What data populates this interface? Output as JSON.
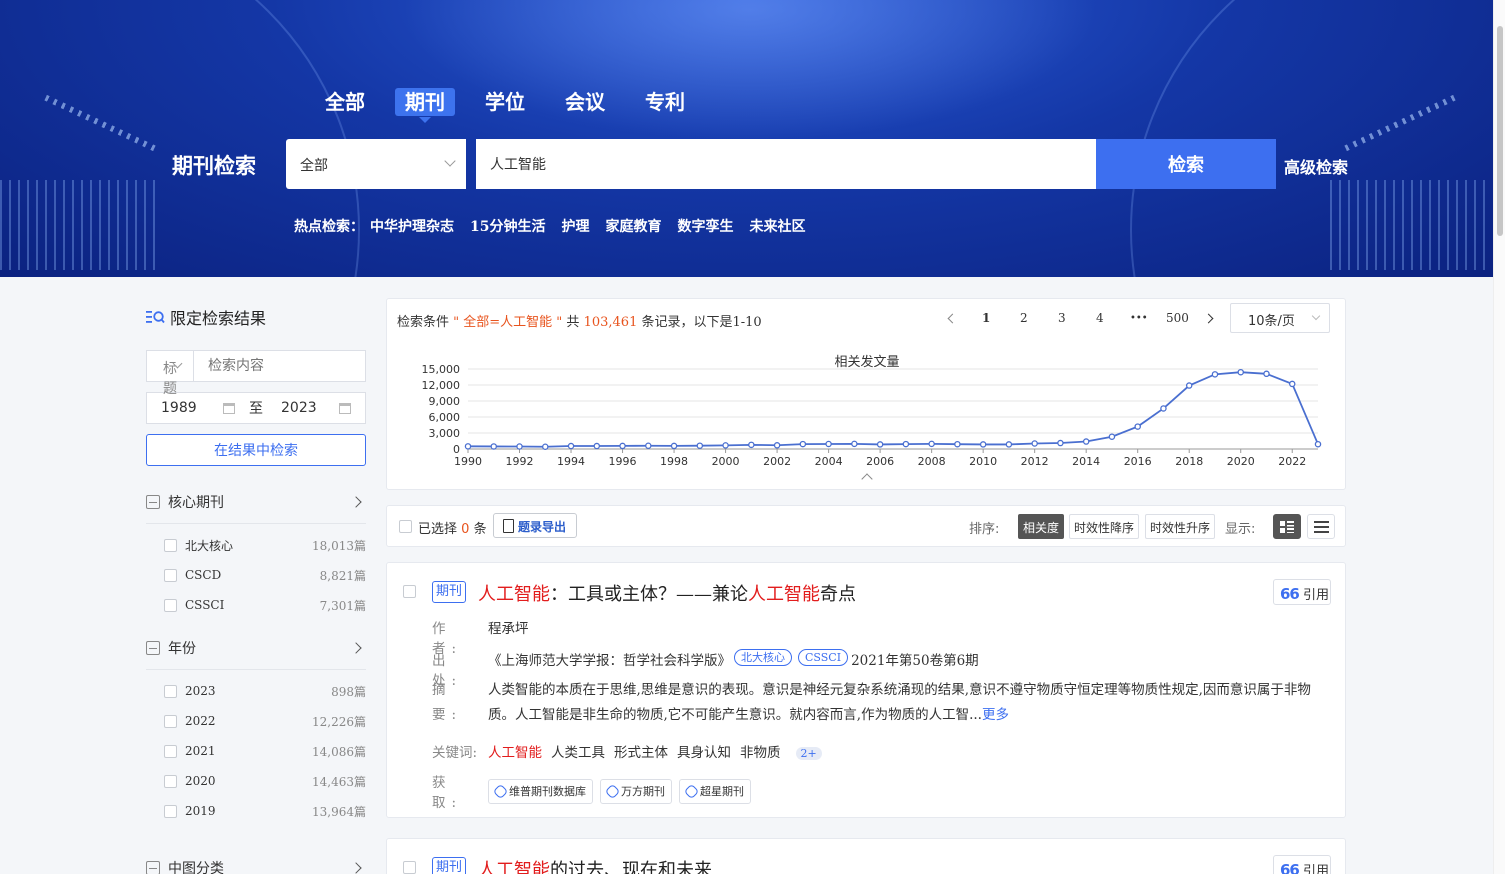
{
  "header": {
    "tabs": [
      {
        "label": "全部",
        "active": false
      },
      {
        "label": "期刊",
        "active": true
      },
      {
        "label": "学位",
        "active": false
      },
      {
        "label": "会议",
        "active": false
      },
      {
        "label": "专利",
        "active": false
      }
    ],
    "title": "期刊检索",
    "scope_value": "全部",
    "query": "人工智能",
    "search_label": "检索",
    "advanced_label": "高级检索",
    "hot_label": "热点检索：",
    "hot_items": [
      "中华护理杂志",
      "15分钟生活",
      "护理",
      "家庭教育",
      "数字孪生",
      "未来社区"
    ]
  },
  "sidebar": {
    "title": "限定检索结果",
    "field_select": "标题",
    "content_placeholder": "检索内容",
    "year_from": "1989",
    "year_to_label": "至",
    "year_to": "2023",
    "refine_label": "在结果中检索",
    "groups": [
      {
        "label": "核心期刊",
        "items": [
          {
            "name": "北大核心",
            "count": "18,013篇"
          },
          {
            "name": "CSCD",
            "count": "8,821篇"
          },
          {
            "name": "CSSCI",
            "count": "7,301篇"
          }
        ]
      },
      {
        "label": "年份",
        "items": [
          {
            "name": "2023",
            "count": "898篇"
          },
          {
            "name": "2022",
            "count": "12,226篇"
          },
          {
            "name": "2021",
            "count": "14,086篇"
          },
          {
            "name": "2020",
            "count": "14,463篇"
          },
          {
            "name": "2019",
            "count": "13,964篇"
          }
        ]
      },
      {
        "label": "中图分类",
        "items": []
      }
    ]
  },
  "summary": {
    "prefix": "检索条件",
    "condition": "\" 全部=人工智能 \"",
    "mid": "共",
    "total": "103,461",
    "suffix": "条记录，以下是1-10",
    "pages": [
      "1",
      "2",
      "3",
      "4",
      "•••",
      "500"
    ],
    "per_page": "10条/页"
  },
  "chart_data": {
    "type": "line",
    "title": "相关发文量",
    "x": [
      1990,
      1991,
      1992,
      1993,
      1994,
      1995,
      1996,
      1997,
      1998,
      1999,
      2000,
      2001,
      2002,
      2003,
      2004,
      2005,
      2006,
      2007,
      2008,
      2009,
      2010,
      2011,
      2012,
      2013,
      2014,
      2015,
      2016,
      2017,
      2018,
      2019,
      2020,
      2021,
      2022,
      2023
    ],
    "values": [
      500,
      480,
      470,
      420,
      560,
      560,
      580,
      610,
      580,
      620,
      680,
      780,
      700,
      920,
      940,
      960,
      860,
      920,
      960,
      900,
      860,
      860,
      1030,
      1120,
      1400,
      2300,
      4200,
      7600,
      11900,
      14000,
      14400,
      14100,
      12200,
      900
    ],
    "x_ticks": [
      "1990",
      "1992",
      "1994",
      "1996",
      "1998",
      "2000",
      "2002",
      "2004",
      "2006",
      "2008",
      "2010",
      "2012",
      "2014",
      "2016",
      "2018",
      "2020",
      "2022"
    ],
    "y_ticks": [
      "0",
      "3,000",
      "6,000",
      "9,000",
      "12,000",
      "15,000"
    ],
    "ylim": [
      0,
      15000
    ],
    "xlim": [
      1990,
      2023
    ],
    "grid": true,
    "color": "#4a6fd0"
  },
  "toolbar": {
    "selected_prefix": "已选择",
    "selected_count": "0",
    "selected_suffix": "条",
    "export_label": "题录导出",
    "sort_label": "排序:",
    "sort_options": [
      "相关度",
      "时效性降序",
      "时效性升序"
    ],
    "show_label": "显示:"
  },
  "results": [
    {
      "type_tag": "期刊",
      "title_kw1": "人工智能",
      "title_mid": "：工具或主体？——兼论",
      "title_kw2": "人工智能",
      "title_end": "奇点",
      "cite_label": "引用",
      "author_label": "作　者:",
      "author": "程承坪",
      "source_label": "出　处:",
      "source": "《上海师范大学学报：哲学社会科学版》",
      "badges": [
        "北大核心",
        "CSSCI"
      ],
      "issue": "2021年第50卷第6期",
      "abstract_label": "摘　要:",
      "abstract": "人类智能的本质在于思维,思维是意识的表现。意识是神经元复杂系统涌现的结果,意识不遵守物质守恒定理等物质性规定,因而意识属于非物质。人工智能是非生命的物质,它不可能产生意识。就内容而言,作为物质的人工智...",
      "more_label": "更多",
      "keywords_label": "关键词:",
      "keywords": [
        "人工智能",
        "人类工具",
        "形式主体",
        "具身认知",
        "非物质"
      ],
      "keywords_more": "2+",
      "access_label": "获　取:",
      "access": [
        "维普期刊数据库",
        "万方期刊",
        "超星期刊"
      ]
    },
    {
      "type_tag": "期刊",
      "title_kw1": "人工智能",
      "title_rest": "的过去、现在和未来",
      "cite_label": "引用"
    }
  ],
  "colors": {
    "accent": "#3d6ff0",
    "highlight": "#e8541e",
    "keyword": "#e21d1d",
    "hero": "#1437a6"
  }
}
